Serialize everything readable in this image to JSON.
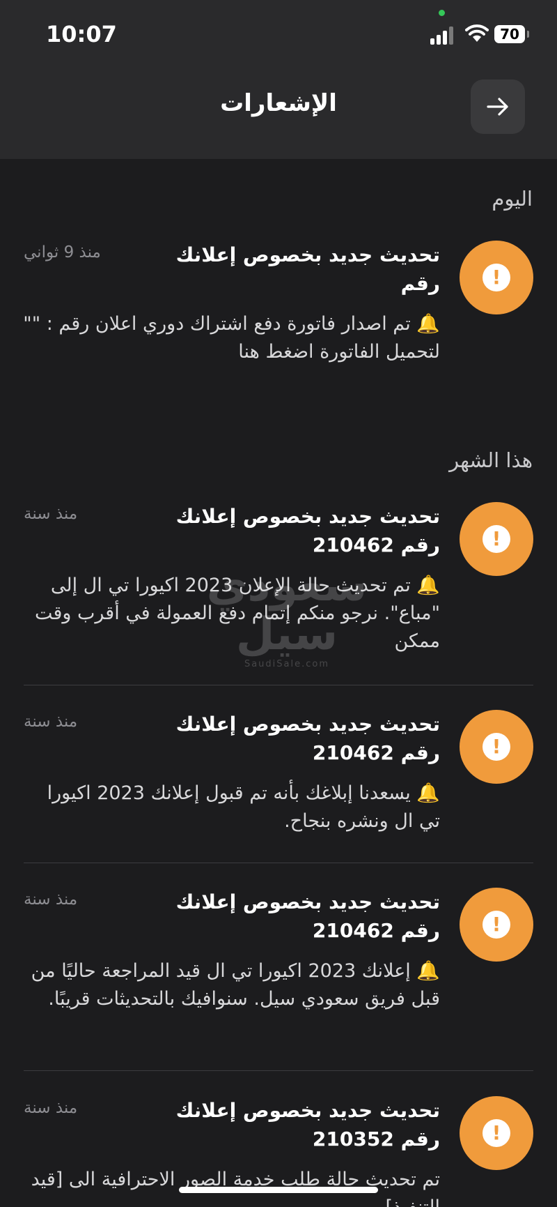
{
  "status_bar": {
    "time": "10:07",
    "battery": "70"
  },
  "header": {
    "title": "الإشعارات"
  },
  "sections": [
    {
      "label": "اليوم"
    },
    {
      "label": "هذا الشهر"
    }
  ],
  "notifications": [
    {
      "title": "تحديث جديد بخصوص إعلانك رقم",
      "time": "منذ 9 ثواني",
      "body": "🔔 تم اصدار فاتورة دفع اشتراك دوري اعلان رقم : \"\" لتحميل الفاتورة اضغط هنا"
    },
    {
      "title": "تحديث جديد بخصوص إعلانك رقم 210462",
      "time": "منذ سنة",
      "body": "🔔 تم تحديث حالة الإعلان 2023 اكيورا تي ال إلى \"مباع\". نرجو منكم إتمام دفع العمولة في أقرب وقت ممكن"
    },
    {
      "title": "تحديث جديد بخصوص إعلانك رقم 210462",
      "time": "منذ سنة",
      "body": "🔔 يسعدنا إبلاغك بأنه تم قبول إعلانك 2023 اكيورا تي ال ونشره بنجاح."
    },
    {
      "title": "تحديث جديد بخصوص إعلانك رقم 210462",
      "time": "منذ سنة",
      "body": "🔔 إعلانك 2023 اكيورا تي ال قيد المراجعة حاليًا من قبل فريق سعودي سيل. سنوافيك بالتحديثات قريبًا."
    },
    {
      "title": "تحديث جديد بخصوص إعلانك رقم 210352",
      "time": "منذ سنة",
      "body": "تم تحديث حالة طلب خدمة الصور الاحترافية الى [قيد التنفيذ]"
    }
  ],
  "watermark": {
    "main": "سعودي سيل",
    "sub": "SaudiSale.com"
  },
  "icons": {
    "back": "arrow-right-icon",
    "alert": "exclamation-icon"
  },
  "colors": {
    "accent": "#f09b3c",
    "background": "#1c1c1e",
    "header": "#2a2a2c"
  }
}
